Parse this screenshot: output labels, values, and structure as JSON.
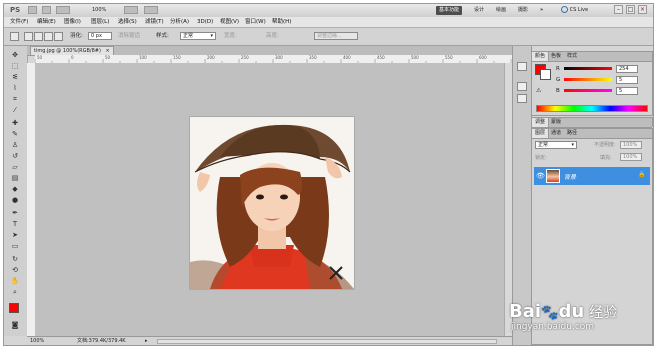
{
  "app": {
    "logo": "PS",
    "zoom": "100%",
    "cs_live": "CS Live"
  },
  "workspaces": [
    "基本功能",
    "设计",
    "绘画",
    "摄影"
  ],
  "workspace_more": "»",
  "menu": [
    "文件(F)",
    "编辑(E)",
    "图像(I)",
    "图层(L)",
    "选择(S)",
    "滤镜(T)",
    "分析(A)",
    "3D(D)",
    "视图(V)",
    "窗口(W)",
    "帮助(H)"
  ],
  "options": {
    "feather_label": "羽化:",
    "feather_value": "0 px",
    "antialias_label": "消除锯齿",
    "style_label": "样式:",
    "style_value": "正常",
    "width_label": "宽度:",
    "height_label": "高度:",
    "refine_label": "调整边缘..."
  },
  "document": {
    "tab_title": "timg.jpg @ 100%(RGB/8#)",
    "status_zoom": "100%",
    "status_doc": "文档:379.4K/379.4K"
  },
  "ruler_ticks": [
    "50",
    "0",
    "50",
    "100",
    "150",
    "200",
    "250",
    "300",
    "350",
    "400",
    "450",
    "500",
    "550",
    "600"
  ],
  "color_panel": {
    "tabs": [
      "颜色",
      "色板",
      "样式"
    ],
    "r_label": "R",
    "g_label": "G",
    "b_label": "B",
    "r_value": "254",
    "g_value": "5",
    "b_value": "5",
    "fg_color": "#fe0505"
  },
  "adjust_panel": {
    "tabs": [
      "调整",
      "蒙版"
    ]
  },
  "layers_panel": {
    "tabs": [
      "图层",
      "通道",
      "路径"
    ],
    "blend_mode": "正常",
    "opacity_label": "不透明度:",
    "opacity_value": "100%",
    "lock_label": "锁定:",
    "fill_label": "填充:",
    "fill_value": "100%",
    "layer_name": "背景"
  },
  "watermark": {
    "brand": "Bai",
    "brand2": "du",
    "text": "经验",
    "url": "jingyan.baidu.com"
  }
}
